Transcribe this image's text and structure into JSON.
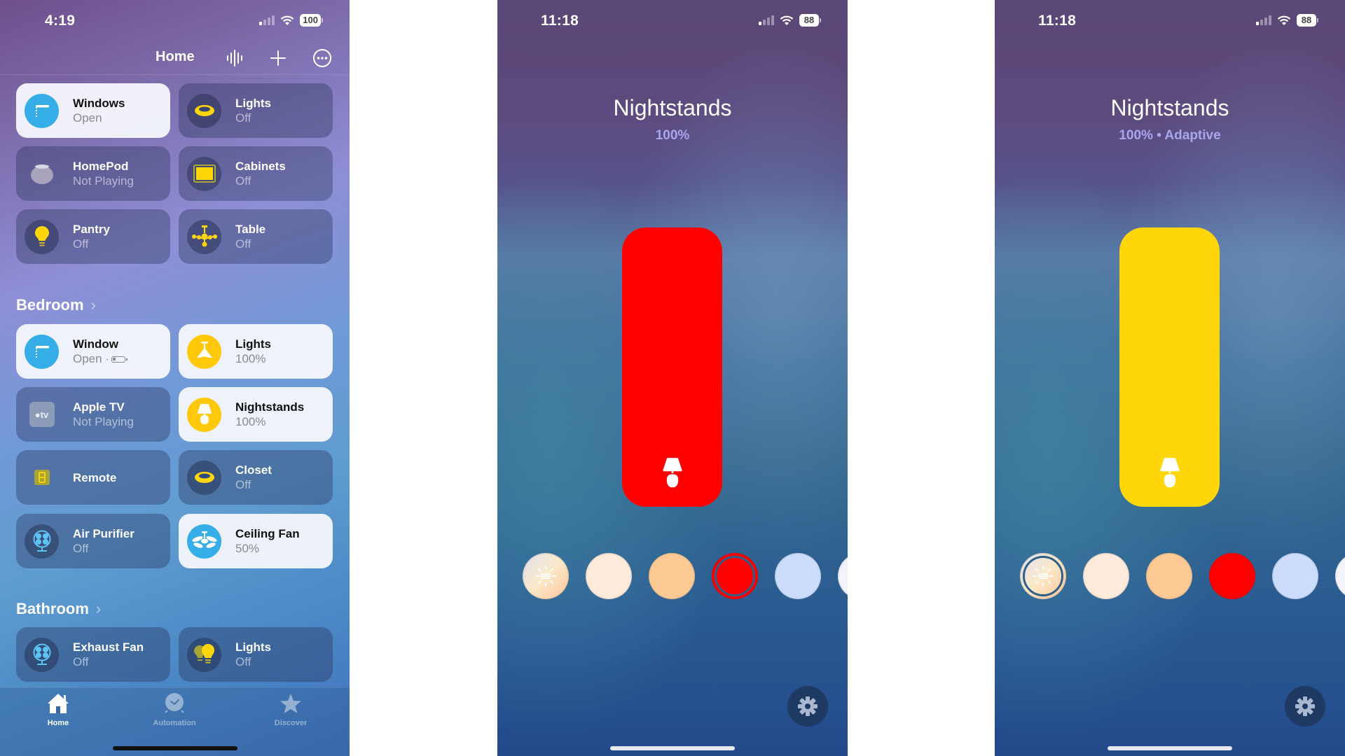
{
  "screens": {
    "home": {
      "status_bar": {
        "time": "4:19",
        "battery": "100"
      },
      "header": {
        "title": "Home"
      },
      "top_tiles": [
        {
          "name": "Windows",
          "state": "Open",
          "icon": "window-shade-icon",
          "active": true
        },
        {
          "name": "Lights",
          "state": "Off",
          "icon": "ceiling-light-icon",
          "active": false
        },
        {
          "name": "HomePod",
          "state": "Not Playing",
          "icon": "homepod-icon",
          "active": false
        },
        {
          "name": "Cabinets",
          "state": "Off",
          "icon": "light-strip-icon",
          "active": false
        },
        {
          "name": "Pantry",
          "state": "Off",
          "icon": "lightbulb-icon",
          "active": false
        },
        {
          "name": "Table",
          "state": "Off",
          "icon": "chandelier-icon",
          "active": false
        }
      ],
      "sections": [
        {
          "title": "Bedroom",
          "tiles": [
            {
              "name": "Window",
              "state": "Open ·",
              "icon": "window-shade-icon",
              "active": true,
              "battery_indicator": true
            },
            {
              "name": "Lights",
              "state": "100%",
              "icon": "pendant-lamp-icon",
              "active": true
            },
            {
              "name": "Apple TV",
              "state": "Not Playing",
              "icon": "apple-tv-icon",
              "active": false
            },
            {
              "name": "Nightstands",
              "state": "100%",
              "icon": "table-lamp-icon",
              "active": true
            },
            {
              "name": "Remote",
              "state": "",
              "icon": "remote-icon",
              "active": false
            },
            {
              "name": "Closet",
              "state": "Off",
              "icon": "ceiling-light-icon",
              "active": false
            },
            {
              "name": "Air Purifier",
              "state": "Off",
              "icon": "fan-icon",
              "active": false
            },
            {
              "name": "Ceiling Fan",
              "state": "50%",
              "icon": "ceiling-fan-icon",
              "active": true
            }
          ]
        },
        {
          "title": "Bathroom",
          "tiles": [
            {
              "name": "Exhaust Fan",
              "state": "Off",
              "icon": "fan-icon",
              "active": false
            },
            {
              "name": "Lights",
              "state": "Off",
              "icon": "lightbulbs-icon",
              "active": false
            }
          ]
        }
      ],
      "tab_bar": [
        {
          "label": "Home",
          "icon": "house-icon",
          "active": true
        },
        {
          "label": "Automation",
          "icon": "clock-icon",
          "active": false
        },
        {
          "label": "Discover",
          "icon": "star-icon",
          "active": false
        }
      ]
    },
    "light_detail_red": {
      "status_bar": {
        "time": "11:18",
        "battery": "88"
      },
      "title": "Nightstands",
      "subtitle": "100%",
      "brightness_percent": 100,
      "light_color": "#ff0000",
      "swatches": [
        {
          "name": "adaptive",
          "color": "gradient",
          "selected": false
        },
        {
          "name": "warm-white",
          "color": "#ffeadb",
          "selected": false
        },
        {
          "name": "peach",
          "color": "#fdc995",
          "selected": false
        },
        {
          "name": "red",
          "color": "#ff0000",
          "selected": true
        },
        {
          "name": "cool-blue",
          "color": "#cbdcfc",
          "selected": false
        },
        {
          "name": "white",
          "color": "#f3f3fb",
          "selected": false
        }
      ]
    },
    "light_detail_yellow": {
      "status_bar": {
        "time": "11:18",
        "battery": "88"
      },
      "title": "Nightstands",
      "subtitle": "100% • Adaptive",
      "brightness_percent": 100,
      "light_color": "#ffd60a",
      "swatches": [
        {
          "name": "adaptive",
          "color": "gradient",
          "selected": true
        },
        {
          "name": "warm-white",
          "color": "#ffeadb",
          "selected": false
        },
        {
          "name": "peach",
          "color": "#fdc995",
          "selected": false
        },
        {
          "name": "red",
          "color": "#ff0000",
          "selected": false
        },
        {
          "name": "cool-blue",
          "color": "#cbdcfc",
          "selected": false
        },
        {
          "name": "white",
          "color": "#f3f3fb",
          "selected": false
        }
      ]
    }
  }
}
